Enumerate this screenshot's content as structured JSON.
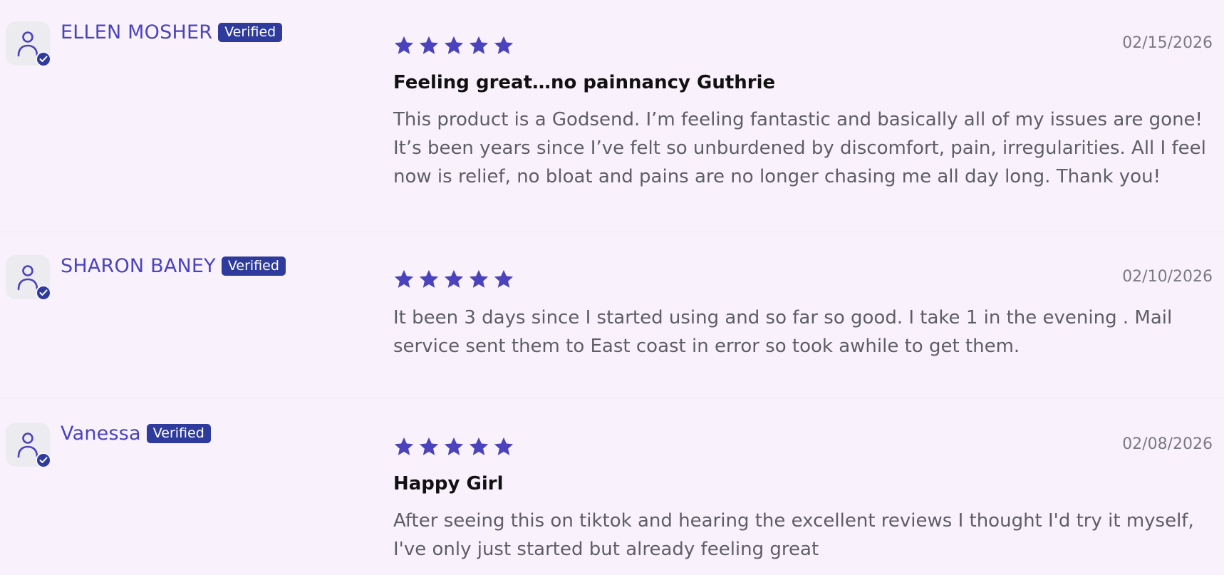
{
  "reviews": [
    {
      "name": "ELLEN MOSHER",
      "badge": "Verified",
      "date": "02/15/2026",
      "rating": 5,
      "title": "Feeling great…no painnancy Guthrie",
      "body": "This product is a Godsend. I’m feeling fantastic and basically all of my issues are gone! It’s been years since I’ve felt so unburdened by discomfort, pain, irregularities. All I feel now is relief, no bloat and pains are no longer chasing me all day long. Thank you!"
    },
    {
      "name": "SHARON BANEY",
      "badge": "Verified",
      "date": "02/10/2026",
      "rating": 5,
      "title": "",
      "body": "It been 3 days since I started using and so far so good. I take 1 in the evening . Mail service sent them to East coast in error so took awhile to get them."
    },
    {
      "name": "Vanessa",
      "badge": "Verified",
      "date": "02/08/2026",
      "rating": 5,
      "title": "Happy Girl",
      "body": "After seeing this on tiktok and hearing the excellent reviews I thought I'd try it myself, I've only just started but already feeling great"
    }
  ],
  "icons": {
    "avatar": "person-icon",
    "verified": "check-badge-icon",
    "star": "star-icon"
  },
  "colors": {
    "background": "#f9f2fc",
    "name": "#4a43bd",
    "badge": "#2f3b9c",
    "star": "#4a43bd",
    "date": "#7a7a82",
    "text": "#5e5e66"
  }
}
